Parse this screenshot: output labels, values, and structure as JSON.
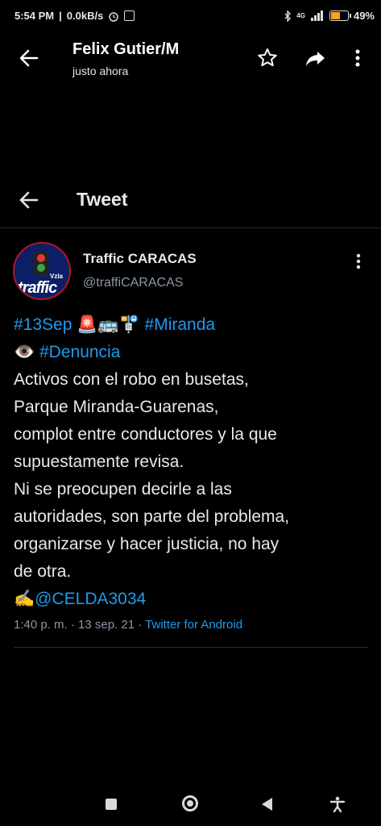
{
  "status_bar": {
    "time": "5:54 PM",
    "speed": "0.0kB/s",
    "network": "4G",
    "battery": "49%",
    "battery_level": 0.49
  },
  "top_bar": {
    "title": "Felix Gutier/M",
    "subtitle": "justo ahora"
  },
  "tweet_header": {
    "title": "Tweet"
  },
  "tweet": {
    "avatar_text": "traffic",
    "avatar_badge": "Vzla",
    "display_name": "Traffic CARACAS",
    "handle": "@traffiCARACAS",
    "line1": {
      "hashtag1": "#13Sep",
      "emojis": "🚨🚌🚏",
      "hashtag2": "#Miranda"
    },
    "line2": {
      "emoji": "👁️",
      "hashtag": "#Denuncia"
    },
    "text_lines": [
      "Activos con el robo en busetas,",
      "Parque Miranda-Guarenas,",
      "complot entre conductores y la que",
      "supuestamente revisa.",
      "Ni se preocupen decirle a las",
      "autoridades, son parte del problema,",
      "organizarse y hacer justicia, no hay",
      "de otra."
    ],
    "signature": {
      "emoji": "✍️",
      "mention": "@CELDA3034"
    },
    "timestamp": "1:40 p. m. · 13 sep. 21 · ",
    "source": "Twitter for Android"
  },
  "colors": {
    "accent": "#1d9bf0",
    "background": "#000000",
    "secondary_text": "#8b98a5"
  }
}
